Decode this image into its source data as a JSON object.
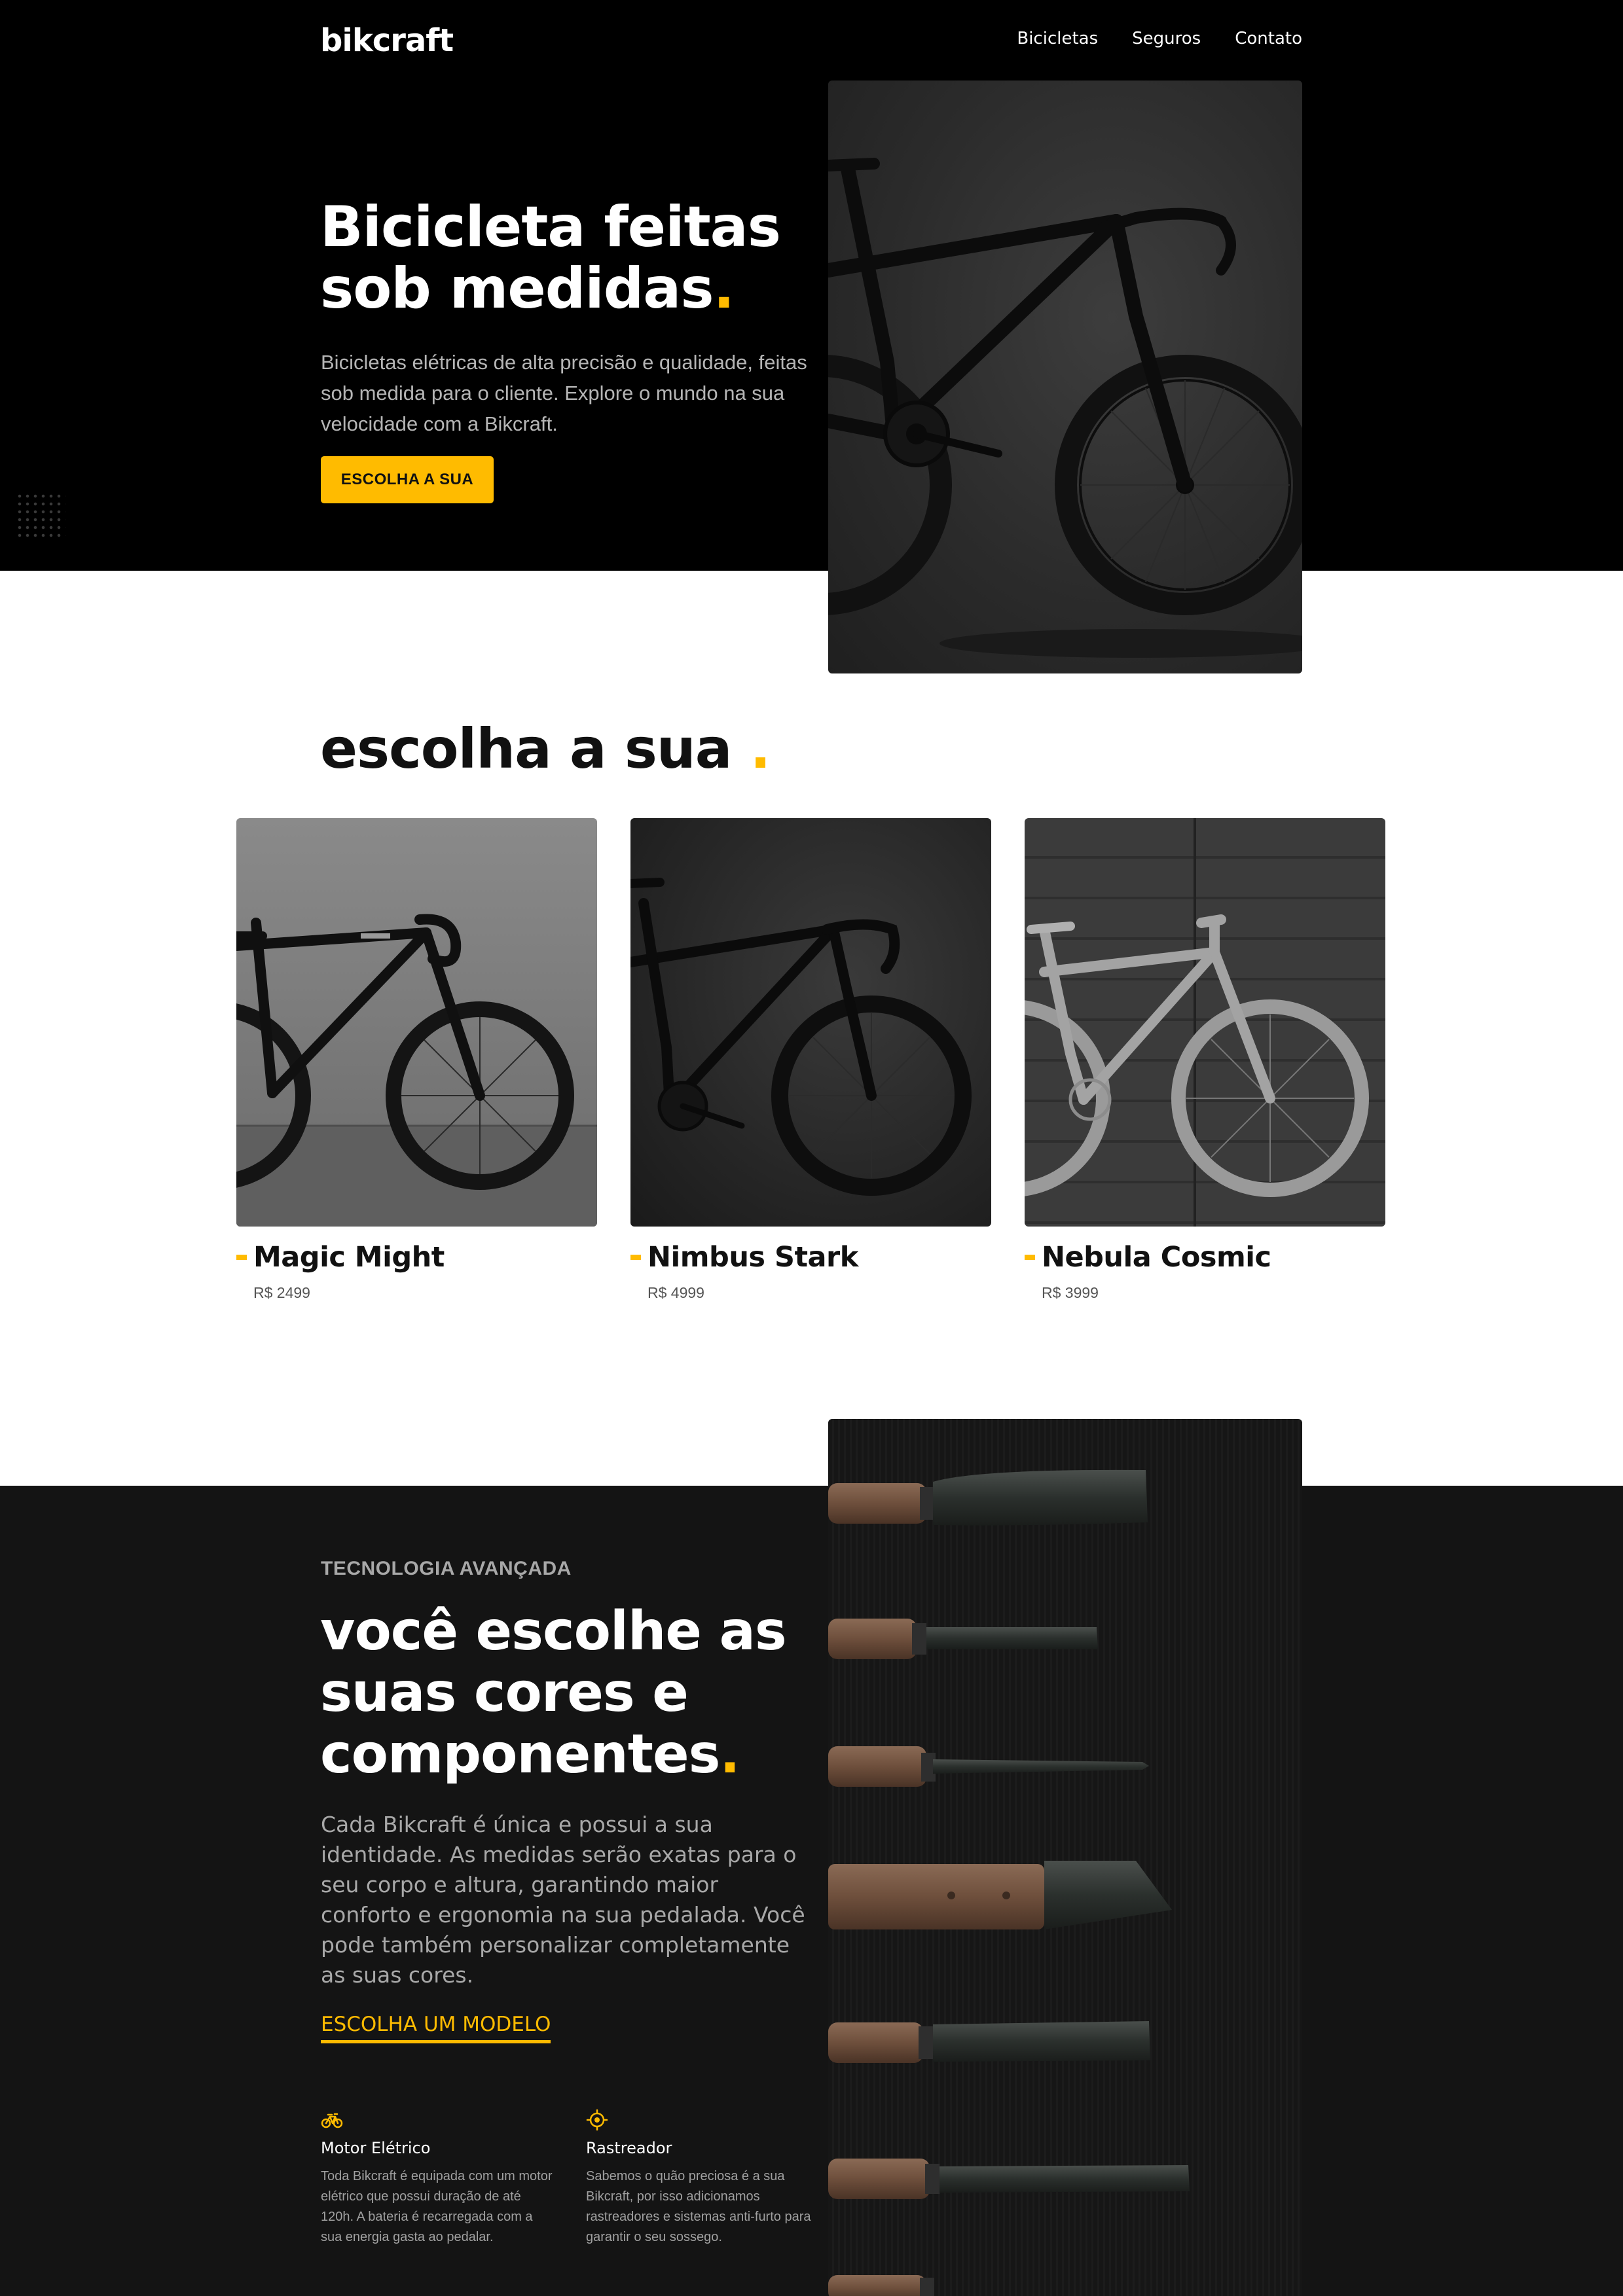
{
  "brand": {
    "logo": "bikcraft",
    "accent_color": "#ffbb00"
  },
  "nav": {
    "items": [
      "Bicicletas",
      "Seguros",
      "Contato"
    ]
  },
  "hero": {
    "title_line1": "Bicicleta feitas",
    "title_line2": "sob medidas",
    "title_dot": ".",
    "text": "Bicicletas elétricas de alta precisão e qualidade, feitas sob medida para o cliente. Explore o mundo na sua velocidade com a Bikcraft.",
    "button_label": "ESCOLHA A SUA"
  },
  "products": {
    "title": "escolha a sua",
    "title_dot": ".",
    "items": [
      {
        "name": "Magic Might",
        "price": "R$ 2499"
      },
      {
        "name": "Nimbus Stark",
        "price": "R$ 4999"
      },
      {
        "name": "Nebula Cosmic",
        "price": "R$ 3999"
      }
    ]
  },
  "technology": {
    "subtitle": "TECNOLOGIA AVANÇADA",
    "title": "você escolhe as suas cores e componentes",
    "title_dot": ".",
    "text": "Cada Bikcraft é única e possui a sua identidade. As medidas serão exatas para o seu corpo e altura, garantindo maior conforto e ergonomia na sua pedalada. Você pode também personalizar completamente as suas cores.",
    "link_label": "ESCOLHA UM MODELO",
    "features": [
      {
        "icon": "electric-bike-icon",
        "title": "Motor Elétrico",
        "text": "Toda Bikcraft é equipada com um motor elétrico que possui duração de até 120h. A bateria é recarregada com a sua energia gasta ao pedalar."
      },
      {
        "icon": "tracker-icon",
        "title": "Rastreador",
        "text": "Sabemos o quão preciosa é a sua Bikcraft, por isso adicionamos rastreadores e sistemas anti-furto para garantir o seu sossego."
      }
    ]
  }
}
